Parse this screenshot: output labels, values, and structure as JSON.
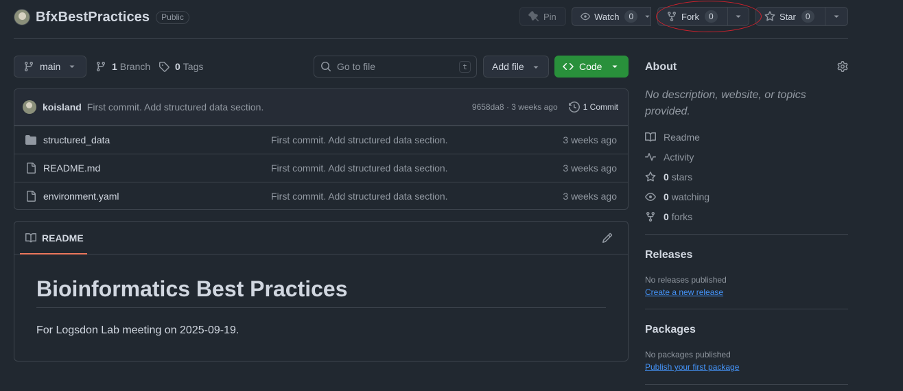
{
  "repo": {
    "name": "BfxBestPractices",
    "visibility": "Public"
  },
  "header_actions": {
    "pin_label": "Pin",
    "watch_label": "Watch",
    "watch_count": "0",
    "fork_label": "Fork",
    "fork_count": "0",
    "star_label": "Star",
    "star_count": "0"
  },
  "toolbar": {
    "branch": "main",
    "branch_count": "1",
    "branch_label": "Branch",
    "tag_count": "0",
    "tag_label": "Tags",
    "search_placeholder": "Go to file",
    "search_shortcut": "t",
    "add_file_label": "Add file",
    "code_label": "Code"
  },
  "latest_commit": {
    "author": "koisland",
    "message": "First commit. Add structured data section.",
    "meta": "9658da8 · 3 weeks ago",
    "commit_count_label": "1 Commit"
  },
  "files": [
    {
      "name": "structured_data",
      "type": "folder",
      "message": "First commit. Add structured data section.",
      "age": "3 weeks ago"
    },
    {
      "name": "README.md",
      "type": "file",
      "message": "First commit. Add structured data section.",
      "age": "3 weeks ago"
    },
    {
      "name": "environment.yaml",
      "type": "file",
      "message": "First commit. Add structured data section.",
      "age": "3 weeks ago"
    }
  ],
  "readme": {
    "tab_label": "README",
    "heading": "Bioinformatics Best Practices",
    "paragraph": "For Logsdon Lab meeting on 2025-09-19."
  },
  "sidebar": {
    "about_title": "About",
    "about_description": "No description, website, or topics provided.",
    "readme_label": "Readme",
    "activity_label": "Activity",
    "stars_count": "0",
    "stars_label": "stars",
    "watching_count": "0",
    "watching_label": "watching",
    "forks_count": "0",
    "forks_label": "forks",
    "releases_title": "Releases",
    "releases_empty": "No releases published",
    "releases_link": "Create a new release",
    "packages_title": "Packages",
    "packages_empty": "No packages published",
    "packages_link": "Publish your first package"
  },
  "colors": {
    "background": "#212830",
    "border": "#3d444d",
    "code_button": "#29903b",
    "link": "#4493f8",
    "readme_tab_underline": "#ec775c",
    "annotation_ring": "#d0212c"
  }
}
